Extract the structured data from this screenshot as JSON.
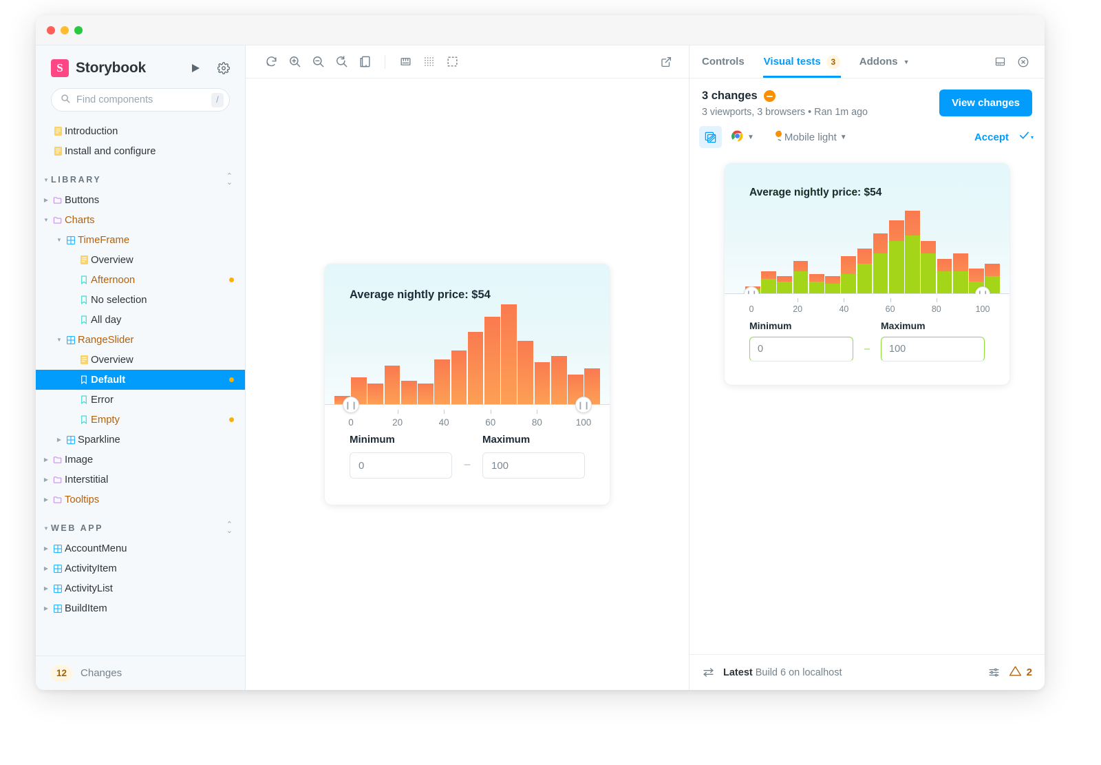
{
  "window": {
    "traffic_lights": [
      "close",
      "minimize",
      "zoom"
    ]
  },
  "sidebar": {
    "brand": "Storybook",
    "brand_logo": "storybook-logo",
    "play_icon": "play-icon",
    "settings_icon": "gear-icon",
    "search": {
      "placeholder": "Find components",
      "value": "",
      "shortcut": "/",
      "icon": "search-icon"
    },
    "top_items": [
      {
        "label": "Introduction",
        "icon": "document-icon"
      },
      {
        "label": "Install and configure",
        "icon": "document-icon"
      }
    ],
    "sections": [
      {
        "title": "LIBRARY",
        "sort_icon": "sort-icon",
        "expanded": true,
        "items": [
          {
            "label": "Buttons",
            "icon": "folder-icon",
            "depth": 0,
            "expanded": false,
            "orange": false,
            "changed": false
          },
          {
            "label": "Charts",
            "icon": "folder-icon",
            "depth": 0,
            "expanded": true,
            "orange": true,
            "changed": false
          },
          {
            "label": "TimeFrame",
            "icon": "component-icon",
            "depth": 1,
            "expanded": true,
            "orange": true,
            "changed": false
          },
          {
            "label": "Overview",
            "icon": "document-icon",
            "depth": 2,
            "expanded": null,
            "orange": false,
            "changed": false
          },
          {
            "label": "Afternoon",
            "icon": "story-icon",
            "depth": 2,
            "expanded": null,
            "orange": true,
            "changed": true
          },
          {
            "label": "No selection",
            "icon": "story-icon",
            "depth": 2,
            "expanded": null,
            "orange": false,
            "changed": false
          },
          {
            "label": "All day",
            "icon": "story-icon",
            "depth": 2,
            "expanded": null,
            "orange": false,
            "changed": false
          },
          {
            "label": "RangeSlider",
            "icon": "component-icon",
            "depth": 1,
            "expanded": true,
            "orange": true,
            "changed": false
          },
          {
            "label": "Overview",
            "icon": "document-icon",
            "depth": 2,
            "expanded": null,
            "orange": false,
            "changed": false
          },
          {
            "label": "Default",
            "icon": "story-icon",
            "depth": 2,
            "expanded": null,
            "orange": false,
            "changed": true,
            "selected": true
          },
          {
            "label": "Error",
            "icon": "story-icon",
            "depth": 2,
            "expanded": null,
            "orange": false,
            "changed": false
          },
          {
            "label": "Empty",
            "icon": "story-icon",
            "depth": 2,
            "expanded": null,
            "orange": true,
            "changed": true
          },
          {
            "label": "Sparkline",
            "icon": "component-icon",
            "depth": 1,
            "expanded": false,
            "orange": false,
            "changed": false
          },
          {
            "label": "Image",
            "icon": "folder-icon",
            "depth": 0,
            "expanded": false,
            "orange": false,
            "changed": false
          },
          {
            "label": "Interstitial",
            "icon": "folder-icon",
            "depth": 0,
            "expanded": false,
            "orange": false,
            "changed": false
          },
          {
            "label": "Tooltips",
            "icon": "folder-icon",
            "depth": 0,
            "expanded": false,
            "orange": true,
            "changed": false
          }
        ]
      },
      {
        "title": "WEB APP",
        "sort_icon": "sort-icon",
        "expanded": true,
        "items": [
          {
            "label": "AccountMenu",
            "icon": "component-icon",
            "depth": 0,
            "expanded": false,
            "orange": false,
            "changed": false
          },
          {
            "label": "ActivityItem",
            "icon": "component-icon",
            "depth": 0,
            "expanded": false,
            "orange": false,
            "changed": false
          },
          {
            "label": "ActivityList",
            "icon": "component-icon",
            "depth": 0,
            "expanded": false,
            "orange": false,
            "changed": false
          },
          {
            "label": "BuildItem",
            "icon": "component-icon",
            "depth": 0,
            "expanded": false,
            "orange": false,
            "changed": false
          }
        ]
      }
    ],
    "footer": {
      "count": "12",
      "label": "Changes"
    }
  },
  "canvas_toolbar": {
    "buttons": [
      {
        "name": "remount-icon",
        "title": "Remount component"
      },
      {
        "name": "zoom-in-icon",
        "title": "Zoom in"
      },
      {
        "name": "zoom-out-icon",
        "title": "Zoom out"
      },
      {
        "name": "zoom-reset-icon",
        "title": "Reset zoom"
      },
      {
        "name": "background-icon",
        "title": "Change background"
      },
      {
        "name": "ruler-icon",
        "title": "Measure"
      },
      {
        "name": "grid-icon",
        "title": "Apply grid"
      },
      {
        "name": "outline-icon",
        "title": "Apply outlines"
      }
    ],
    "open_new_tab_icon": "open-in-new-icon"
  },
  "story": {
    "title": "Average nightly price: $54",
    "min_label": "Minimum",
    "max_label": "Maximum",
    "min_value": "0",
    "max_value": "100",
    "separator": "–",
    "left_handle_icon": "slider-handle-icon",
    "right_handle_icon": "slider-handle-icon"
  },
  "panel": {
    "tabs": [
      {
        "label": "Controls",
        "badge": null,
        "active": false
      },
      {
        "label": "Visual tests",
        "badge": "3",
        "active": true
      },
      {
        "label": "Addons",
        "badge": null,
        "active": false,
        "caret": true
      }
    ],
    "dock_icon": "dock-bottom-icon",
    "close_icon": "close-panel-icon",
    "summary": {
      "headline": "3 changes",
      "status_icon": "changes-status-icon",
      "subline": "3 viewports, 3 browsers • Ran 1m ago",
      "view_changes_label": "View changes"
    },
    "controls": {
      "diff_toggle_icon": "diff-toggle-icon",
      "browser_label": "Chrome",
      "browser_icon": "chrome-icon",
      "viewport_label": "Mobile light",
      "viewport_icon": "viewport-status-icon",
      "accept_label": "Accept",
      "accept_check_icon": "check-icon",
      "accept_caret_icon": "chevron-down-icon"
    },
    "footer": {
      "swap_icon": "compare-icon",
      "build_strong": "Latest",
      "build_text": "Build 6 on localhost",
      "settings_icon": "sliders-icon",
      "warning_icon": "warning-icon",
      "warning_count": "2"
    }
  },
  "chart_data": {
    "type": "bar",
    "title": "Average nightly price: $54",
    "xlabel": "",
    "ylabel": "",
    "xlim": [
      0,
      100
    ],
    "ylim": [
      0,
      34
    ],
    "grid": false,
    "legend": null,
    "tick_labels": [
      "0",
      "20",
      "40",
      "60",
      "80",
      "100"
    ],
    "tick_values": [
      0,
      20,
      40,
      60,
      80,
      100
    ],
    "bin_width": 6.25,
    "categories": [
      "0-6",
      "6-12",
      "12-19",
      "19-25",
      "25-31",
      "31-38",
      "38-44",
      "44-50",
      "50-56",
      "56-62",
      "62-69",
      "69-75",
      "75-81",
      "81-88",
      "88-94",
      "94-100"
    ],
    "values": [
      3,
      9,
      7,
      13,
      8,
      7,
      15,
      18,
      24,
      29,
      33,
      21,
      14,
      16,
      10,
      12
    ],
    "diff_values": [
      2,
      6,
      5,
      9,
      5,
      4,
      8,
      12,
      16,
      21,
      23,
      16,
      9,
      9,
      5,
      7
    ],
    "bar_color": "#fb8450",
    "diff_color": "#a4d518",
    "background": "#e9f7fa"
  }
}
